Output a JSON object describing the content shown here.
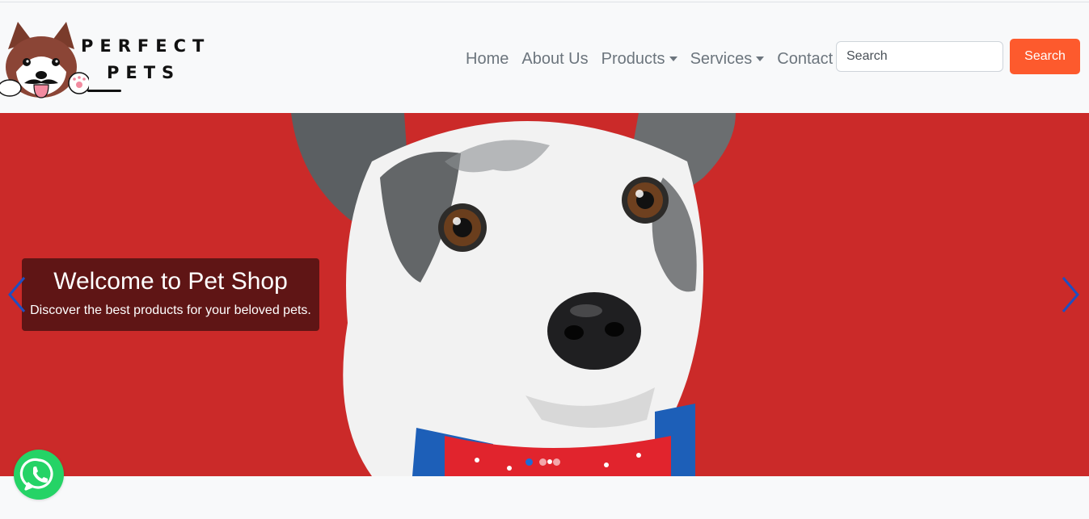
{
  "brand": {
    "line1": "PERFECT",
    "line2": "PETS",
    "logo_icon": "husky-dog-logo"
  },
  "nav": {
    "items": [
      {
        "label": "Home",
        "dropdown": false
      },
      {
        "label": "About Us",
        "dropdown": false
      },
      {
        "label": "Products",
        "dropdown": true
      },
      {
        "label": "Services",
        "dropdown": true
      },
      {
        "label": "Contact",
        "dropdown": false
      }
    ]
  },
  "search": {
    "placeholder": "Search",
    "button_label": "Search"
  },
  "carousel": {
    "title": "Welcome to Pet Shop",
    "subtitle": "Discover the best products for your beloved pets.",
    "active_slide": 1,
    "slide_count": 3,
    "background_color": "#cb2a29"
  },
  "colors": {
    "accent": "#fd5a2d",
    "indicator_active": "#1e6bd6",
    "whatsapp": "#25d366"
  },
  "floating": {
    "icon": "whatsapp-icon"
  }
}
